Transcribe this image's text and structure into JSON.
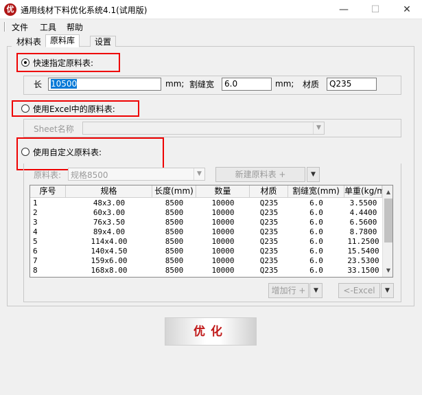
{
  "window": {
    "icon_text": "优",
    "title": "通用线材下料优化系统4.1(试用版)",
    "minimize": "—",
    "maximize": "☐",
    "close": "✕"
  },
  "menu": {
    "file": "文件",
    "tools": "工具",
    "help": "帮助"
  },
  "tabs": [
    {
      "label": "材料表",
      "active": false
    },
    {
      "label": "原料库",
      "active": true
    },
    {
      "label": "设置",
      "active": false
    }
  ],
  "option_quick": {
    "label": "快速指定原料表:",
    "selected": true,
    "length_label": "长",
    "length_value": "10500",
    "length_unit": "mm;",
    "kerf_label": "割缝宽",
    "kerf_value": "6.0",
    "kerf_unit": "mm;",
    "material_label": "材质",
    "material_value": "Q235"
  },
  "option_excel": {
    "label": "使用Excel中的原料表:",
    "selected": false,
    "sheet_label": "Sheet名称"
  },
  "option_custom": {
    "label": "使用自定义原料表:",
    "selected": false,
    "raw_table_label": "原料表:",
    "raw_table_value": "规格8500",
    "new_table_button": "新建原料表 +",
    "add_row_button": "增加行 +",
    "excel_button": "<-Excel"
  },
  "table": {
    "columns": [
      "序号",
      "规格",
      "长度(mm)",
      "数量",
      "材质",
      "割缝宽(mm)",
      "单重(kg/m)"
    ],
    "rows": [
      [
        "1",
        "48x3.00",
        "8500",
        "10000",
        "Q235",
        "6.0",
        "3.5500"
      ],
      [
        "2",
        "60x3.00",
        "8500",
        "10000",
        "Q235",
        "6.0",
        "4.4400"
      ],
      [
        "3",
        "76x3.50",
        "8500",
        "10000",
        "Q235",
        "6.0",
        "6.5600"
      ],
      [
        "4",
        "89x4.00",
        "8500",
        "10000",
        "Q235",
        "6.0",
        "8.7800"
      ],
      [
        "5",
        "114x4.00",
        "8500",
        "10000",
        "Q235",
        "6.0",
        "11.2500"
      ],
      [
        "6",
        "140x4.50",
        "8500",
        "10000",
        "Q235",
        "6.0",
        "15.5400"
      ],
      [
        "7",
        "159x6.00",
        "8500",
        "10000",
        "Q235",
        "6.0",
        "23.5300"
      ],
      [
        "8",
        "168x8.00",
        "8500",
        "10000",
        "Q235",
        "6.0",
        "33.1500"
      ]
    ]
  },
  "optimize_button": "优化",
  "icons": {
    "scroll_up": "▲",
    "scroll_down": "▼",
    "dropdown": "▼"
  }
}
